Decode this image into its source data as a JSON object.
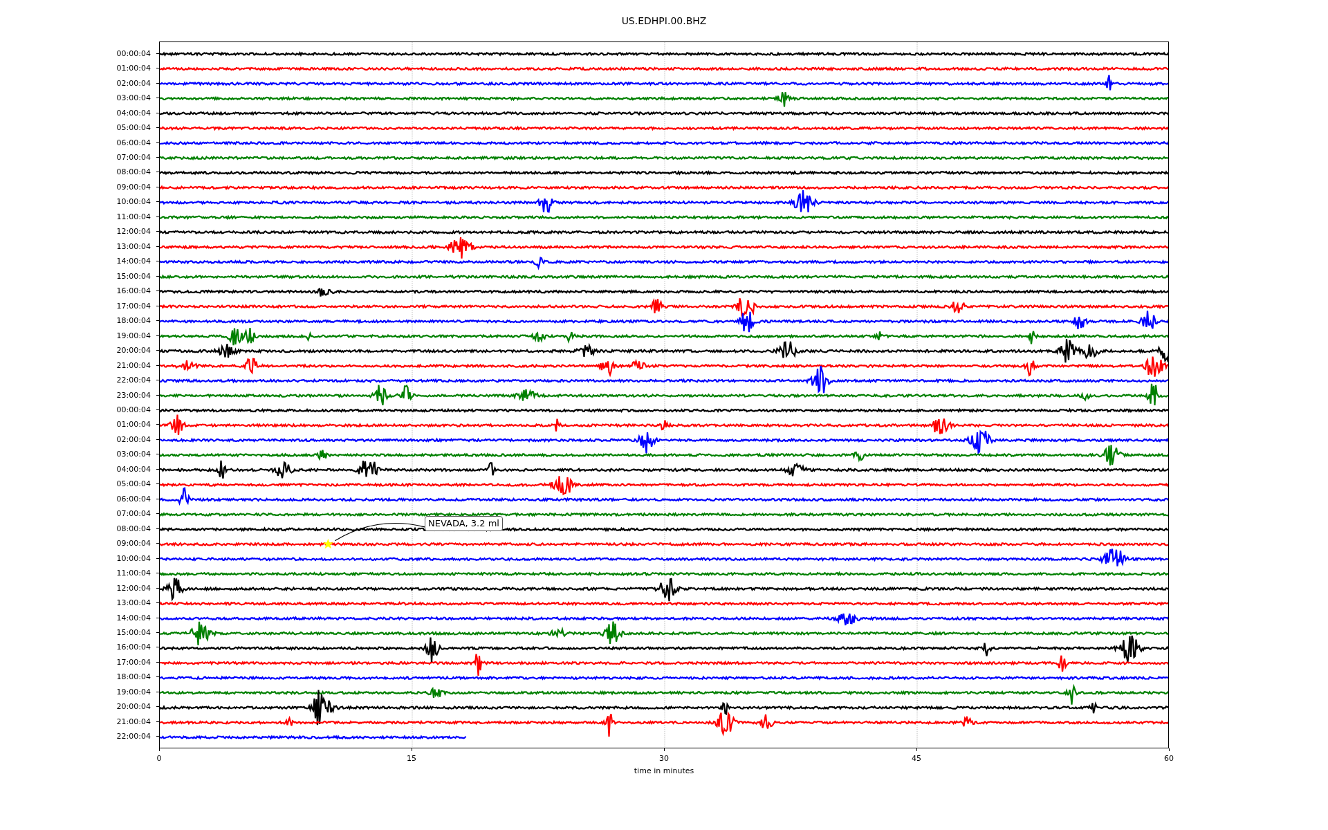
{
  "title": "US.EDHPI.00.BHZ",
  "traces": [
    {
      "label": "00:00:04",
      "color": "#000000",
      "kind": "full"
    },
    {
      "label": "01:00:04",
      "color": "#ff0000",
      "kind": "full"
    },
    {
      "label": "02:00:04",
      "color": "#0000ff",
      "kind": "full"
    },
    {
      "label": "03:00:04",
      "color": "#008000",
      "kind": "full"
    },
    {
      "label": "04:00:04",
      "color": "#000000",
      "kind": "full"
    },
    {
      "label": "05:00:04",
      "color": "#ff0000",
      "kind": "full"
    },
    {
      "label": "06:00:04",
      "color": "#0000ff",
      "kind": "full"
    },
    {
      "label": "07:00:04",
      "color": "#008000",
      "kind": "full"
    },
    {
      "label": "08:00:04",
      "color": "#000000",
      "kind": "full"
    },
    {
      "label": "09:00:04",
      "color": "#ff0000",
      "kind": "full"
    },
    {
      "label": "10:00:04",
      "color": "#0000ff",
      "kind": "full"
    },
    {
      "label": "11:00:04",
      "color": "#008000",
      "kind": "full"
    },
    {
      "label": "12:00:04",
      "color": "#000000",
      "kind": "full"
    },
    {
      "label": "13:00:04",
      "color": "#ff0000",
      "kind": "full"
    },
    {
      "label": "14:00:04",
      "color": "#0000ff",
      "kind": "full"
    },
    {
      "label": "15:00:04",
      "color": "#008000",
      "kind": "full"
    },
    {
      "label": "16:00:04",
      "color": "#000000",
      "kind": "full"
    },
    {
      "label": "17:00:04",
      "color": "#ff0000",
      "kind": "full"
    },
    {
      "label": "18:00:04",
      "color": "#0000ff",
      "kind": "full"
    },
    {
      "label": "19:00:04",
      "color": "#008000",
      "kind": "full"
    },
    {
      "label": "20:00:04",
      "color": "#000000",
      "kind": "full"
    },
    {
      "label": "21:00:04",
      "color": "#ff0000",
      "kind": "full"
    },
    {
      "label": "22:00:04",
      "color": "#0000ff",
      "kind": "full"
    },
    {
      "label": "23:00:04",
      "color": "#008000",
      "kind": "full"
    },
    {
      "label": "00:00:04",
      "color": "#000000",
      "kind": "full"
    },
    {
      "label": "01:00:04",
      "color": "#ff0000",
      "kind": "full"
    },
    {
      "label": "02:00:04",
      "color": "#0000ff",
      "kind": "full"
    },
    {
      "label": "03:00:04",
      "color": "#008000",
      "kind": "full"
    },
    {
      "label": "04:00:04",
      "color": "#000000",
      "kind": "full"
    },
    {
      "label": "05:00:04",
      "color": "#ff0000",
      "kind": "full"
    },
    {
      "label": "06:00:04",
      "color": "#0000ff",
      "kind": "full"
    },
    {
      "label": "07:00:04",
      "color": "#008000",
      "kind": "full"
    },
    {
      "label": "08:00:04",
      "color": "#000000",
      "kind": "full"
    },
    {
      "label": "09:00:04",
      "color": "#ff0000",
      "kind": "full"
    },
    {
      "label": "10:00:04",
      "color": "#0000ff",
      "kind": "full"
    },
    {
      "label": "11:00:04",
      "color": "#008000",
      "kind": "full"
    },
    {
      "label": "12:00:04",
      "color": "#000000",
      "kind": "full"
    },
    {
      "label": "13:00:04",
      "color": "#ff0000",
      "kind": "full"
    },
    {
      "label": "14:00:04",
      "color": "#0000ff",
      "kind": "full"
    },
    {
      "label": "15:00:04",
      "color": "#008000",
      "kind": "full"
    },
    {
      "label": "16:00:04",
      "color": "#000000",
      "kind": "full"
    },
    {
      "label": "17:00:04",
      "color": "#ff0000",
      "kind": "full"
    },
    {
      "label": "18:00:04",
      "color": "#0000ff",
      "kind": "full"
    },
    {
      "label": "19:00:04",
      "color": "#008000",
      "kind": "full"
    },
    {
      "label": "20:00:04",
      "color": "#000000",
      "kind": "full"
    },
    {
      "label": "21:00:04",
      "color": "#ff0000",
      "kind": "full"
    },
    {
      "label": "22:00:04",
      "color": "#0000ff",
      "kind": "partial"
    }
  ],
  "xticks": [
    "0",
    "15",
    "30",
    "45",
    "60"
  ],
  "xlabel": "time in minutes",
  "annotation": {
    "text": "NEVADA, 3.2 ml"
  }
}
